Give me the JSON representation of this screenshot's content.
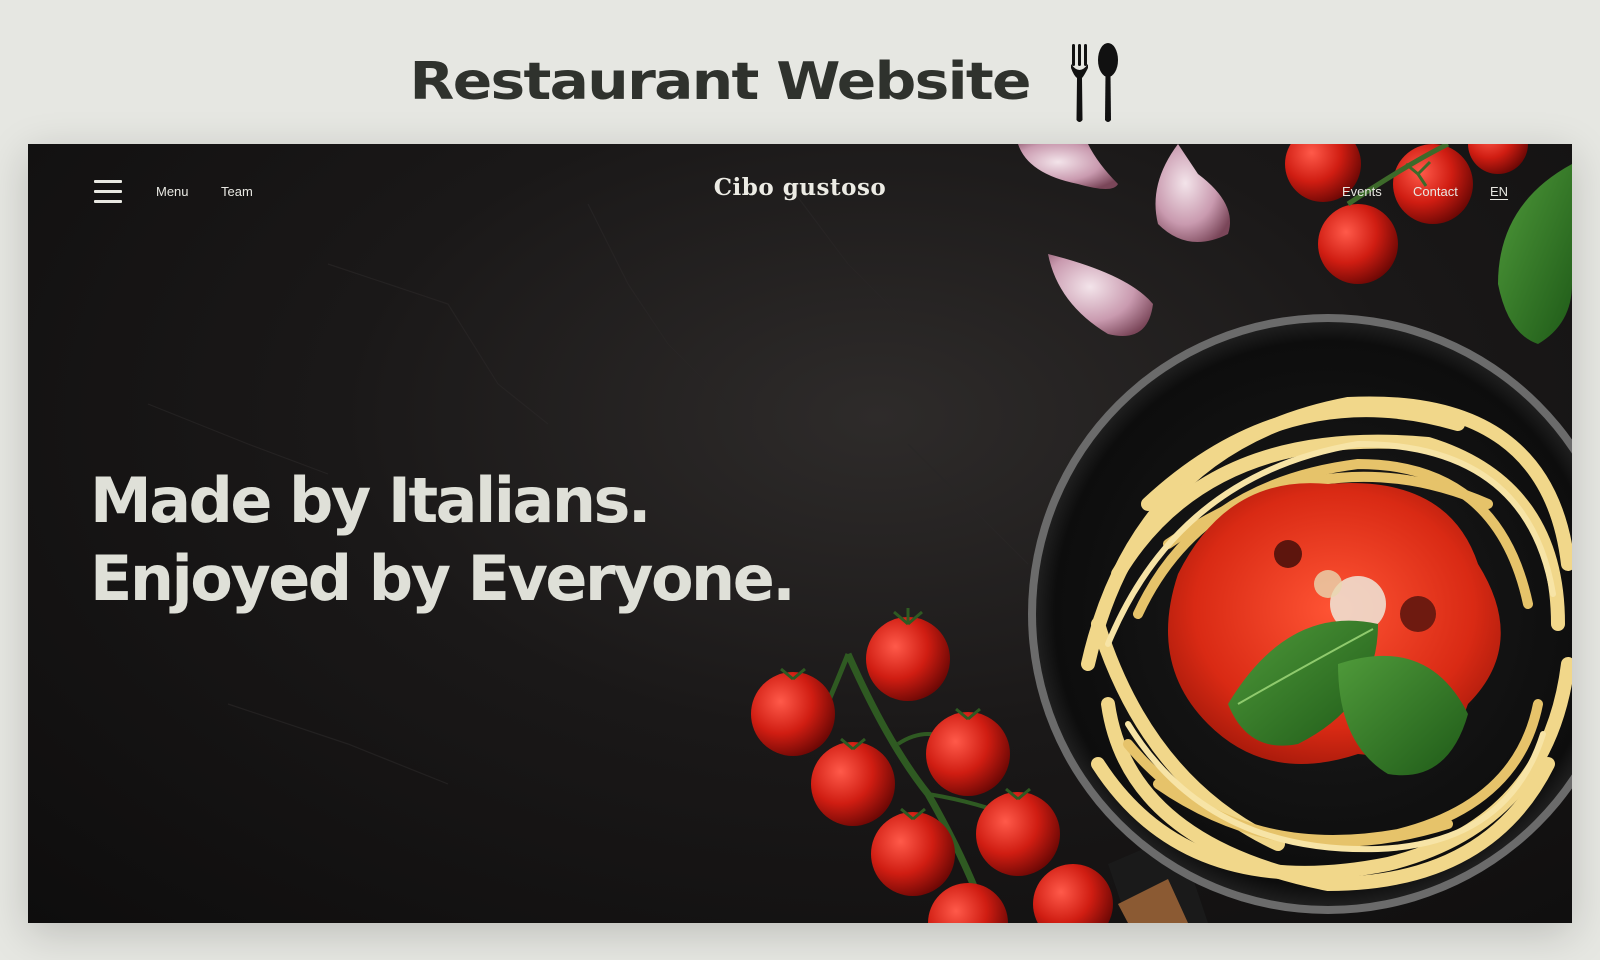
{
  "presentation": {
    "title": "Restaurant Website",
    "icon": "fork-and-spoon-icon"
  },
  "nav": {
    "menu_icon": "hamburger-menu-icon",
    "left_links": [
      "Menu",
      "Team"
    ],
    "brand": "Cibo gustoso",
    "right_links": [
      "Events",
      "Contact"
    ],
    "language": "EN"
  },
  "hero": {
    "headline_line1": "Made by Italians.",
    "headline_line2": "Enjoyed by Everyone.",
    "image": "pasta-pan-with-tomatoes-basil-garlic"
  },
  "colors": {
    "page_background": "#e6e7e2",
    "title_text": "#2f322d",
    "hero_background": "#151414",
    "hero_text": "#dfe0d8",
    "nav_text": "#e8e8e2"
  }
}
